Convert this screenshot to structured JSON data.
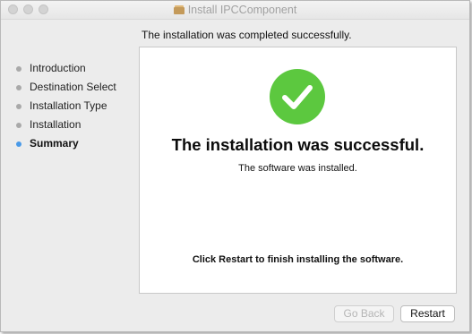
{
  "window": {
    "title": "Install IPCComponent",
    "title_icon": "package-icon"
  },
  "header": {
    "status_text": "The installation was completed successfully."
  },
  "sidebar": {
    "steps": [
      {
        "label": "Introduction",
        "state": "done"
      },
      {
        "label": "Destination Select",
        "state": "done"
      },
      {
        "label": "Installation Type",
        "state": "done"
      },
      {
        "label": "Installation",
        "state": "done"
      },
      {
        "label": "Summary",
        "state": "current"
      }
    ]
  },
  "main": {
    "icon": "success-checkmark-icon",
    "title": "The installation was successful.",
    "subtitle": "The software was installed.",
    "instruction": "Click Restart to finish installing the software."
  },
  "buttons": {
    "back_label": "Go Back",
    "back_enabled": false,
    "restart_label": "Restart"
  },
  "colors": {
    "success_green": "#5cc83f",
    "active_step_dot": "#4a9ae8",
    "inactive_step_dot": "#a9a9a9"
  }
}
